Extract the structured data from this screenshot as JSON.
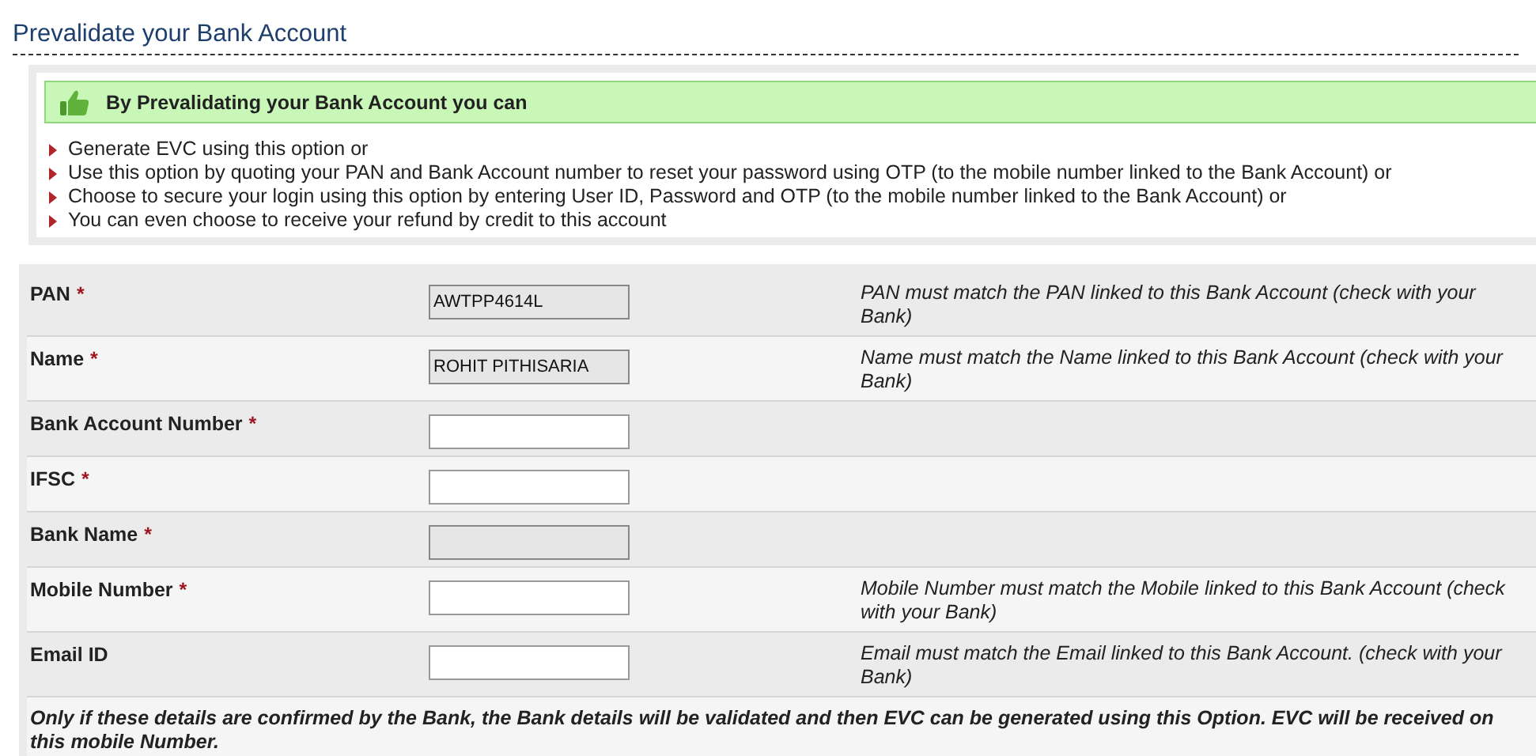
{
  "title": "Prevalidate your Bank Account",
  "banner": {
    "text": "By Prevalidating your Bank Account you can"
  },
  "options": [
    "Generate EVC using this option or",
    "Use this option by quoting your PAN and Bank Account number to reset your password using OTP (to the mobile number linked to the Bank Account) or",
    "Choose to secure your login using this option by entering User ID, Password and OTP (to the mobile number linked to the Bank Account) or",
    "You can even choose to receive your refund by credit to this account"
  ],
  "fields": [
    {
      "label": "PAN",
      "required_mark": "*",
      "value": "AWTPP4614L",
      "disabled": true,
      "hint": "PAN must match the PAN linked to this Bank Account (check with your Bank)"
    },
    {
      "label": "Name",
      "required_mark": "*",
      "value": "ROHIT PITHISARIA",
      "disabled": true,
      "hint": "Name must match the Name linked to this Bank Account (check with your Bank)"
    },
    {
      "label": "Bank Account Number",
      "required_mark": "*",
      "disabled": false
    },
    {
      "label": "IFSC",
      "required_mark": "*",
      "disabled": false
    },
    {
      "label": "Bank Name",
      "required_mark": "*",
      "disabled": true
    },
    {
      "label": "Mobile Number",
      "required_mark": "*",
      "disabled": false,
      "hint": "Mobile Number must match the Mobile linked to this Bank Account (check with your Bank)"
    },
    {
      "label": "Email ID",
      "disabled": false,
      "hint": "Email must match the Email linked to this Bank Account. (check with your Bank)"
    }
  ],
  "note": "Only if these details are confirmed by the Bank, the Bank details will be validated and then EVC can be generated using this Option. EVC will be received on this mobile Number."
}
